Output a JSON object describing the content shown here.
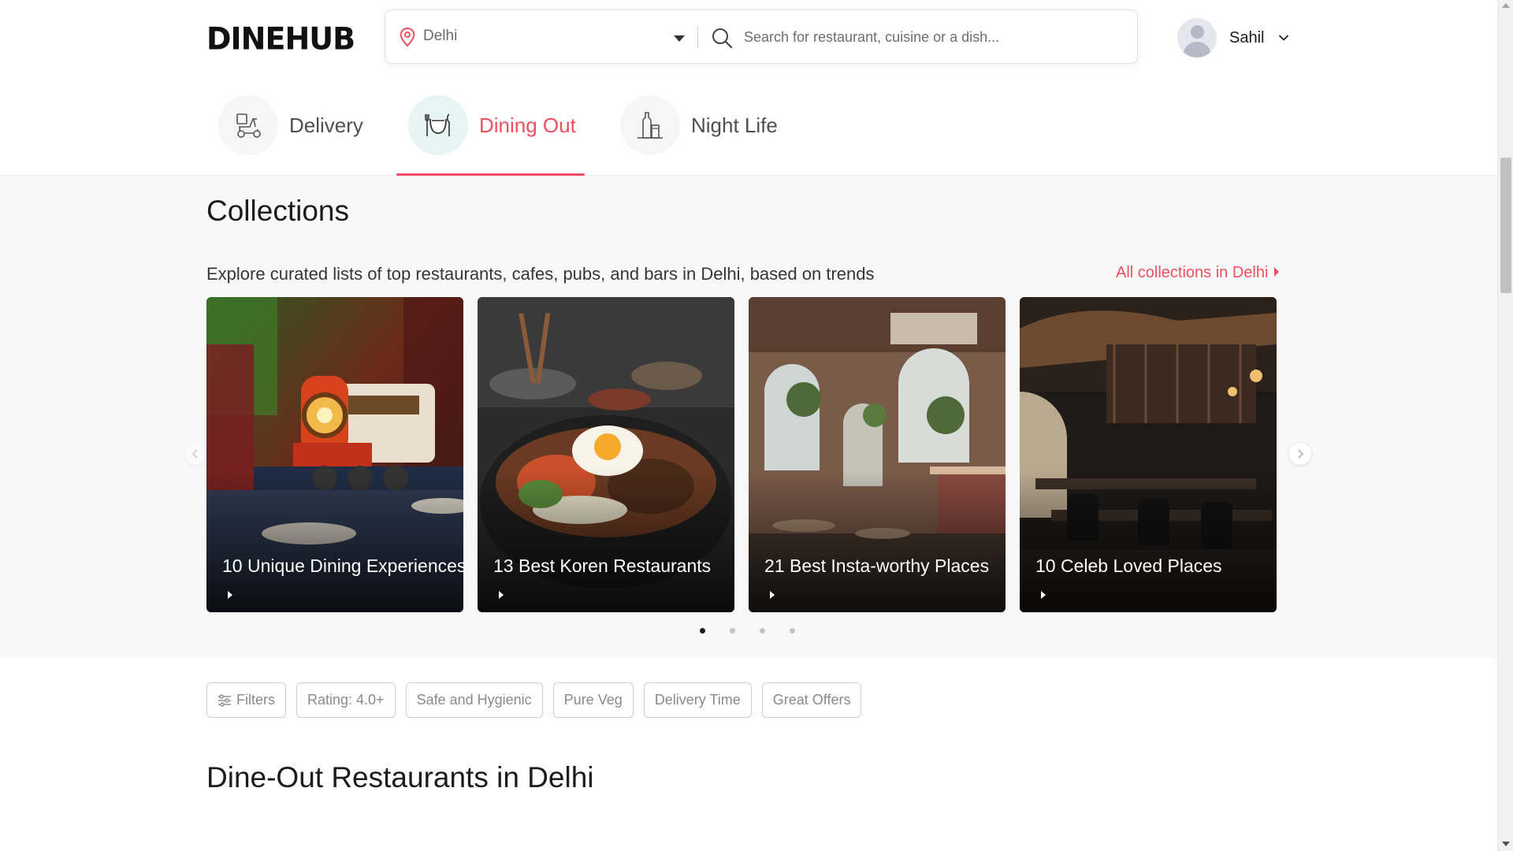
{
  "header": {
    "logo": "DINEHUB",
    "location": "Delhi",
    "search_placeholder": "Search for restaurant, cuisine or a dish...",
    "user_name": "Sahil"
  },
  "tabs": [
    {
      "label": "Delivery",
      "icon": "scooter-icon",
      "active": false
    },
    {
      "label": "Dining Out",
      "icon": "dining-icon",
      "active": true
    },
    {
      "label": "Night Life",
      "icon": "drinks-icon",
      "active": false
    }
  ],
  "collections": {
    "title": "Collections",
    "subtitle": "Explore curated lists of top restaurants, cafes, pubs, and bars in Delhi, based on trends",
    "all_link": "All collections in Delhi",
    "cards": [
      {
        "title": "10 Unique Dining Experiences",
        "image": "toy train on dining table"
      },
      {
        "title": "13 Best Koren Restaurants",
        "image": "korean bibimbap bowl"
      },
      {
        "title": "21 Best Insta-worthy Places",
        "image": "cafe interior with arches"
      },
      {
        "title": "10 Celeb Loved Places",
        "image": "dark restaurant interior"
      }
    ],
    "page_count": 4,
    "active_page": 1
  },
  "filters": [
    "Filters",
    "Rating: 4.0+",
    "Safe and Hygienic",
    "Pure Veg",
    "Delivery Time",
    "Great Offers"
  ],
  "section_title": "Dine-Out Restaurants in Delhi",
  "colors": {
    "accent": "#ef4f5f",
    "active_tab_bg": "#e6f5f4",
    "collections_bg": "#f8f8f8"
  }
}
